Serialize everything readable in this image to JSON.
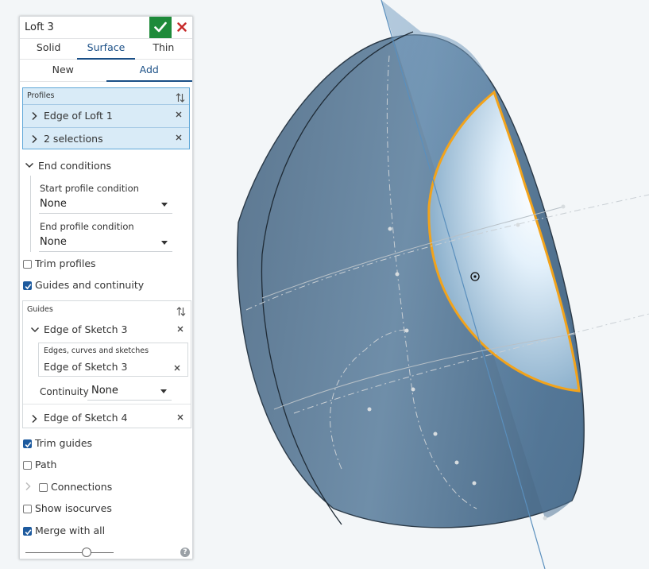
{
  "dialog": {
    "title": "Loft 3",
    "colors": {
      "accept": "#1e8a3a",
      "close": "#c62828",
      "accent": "#1a4f86",
      "selection_bg": "#d9ebf7",
      "selection_border": "#5ea7d8",
      "checkbox_on": "#1d5a9e",
      "profile_highlight": "#f2a31b"
    },
    "type_tabs": [
      {
        "label": "Solid",
        "active": false
      },
      {
        "label": "Surface",
        "active": true
      },
      {
        "label": "Thin",
        "active": false
      }
    ],
    "op_tabs": [
      {
        "label": "New",
        "active": false
      },
      {
        "label": "Add",
        "active": true
      }
    ],
    "profiles": {
      "label": "Profiles",
      "items": [
        {
          "label": "Edge of Loft 1"
        },
        {
          "label": "2 selections"
        }
      ]
    },
    "end_conditions": {
      "label": "End conditions",
      "start_label": "Start profile condition",
      "start_value": "None",
      "end_label": "End profile condition",
      "end_value": "None"
    },
    "trim_profiles": {
      "label": "Trim profiles",
      "checked": false
    },
    "guides_continuity": {
      "label": "Guides and continuity",
      "checked": true
    },
    "guides": {
      "label": "Guides",
      "items": [
        {
          "label": "Edge of Sketch 3",
          "expanded": true,
          "sub_label": "Edges, curves and sketches",
          "sub_value": "Edge of Sketch 3",
          "continuity_label": "Continuity",
          "continuity_value": "None"
        },
        {
          "label": "Edge of Sketch 4",
          "expanded": false
        }
      ]
    },
    "trim_guides": {
      "label": "Trim guides",
      "checked": true
    },
    "path": {
      "label": "Path",
      "checked": false
    },
    "connections": {
      "label": "Connections",
      "checked": false
    },
    "show_isocurves": {
      "label": "Show isocurves",
      "checked": false
    },
    "merge_with_all": {
      "label": "Merge with all",
      "checked": true
    },
    "help_label": "?"
  }
}
